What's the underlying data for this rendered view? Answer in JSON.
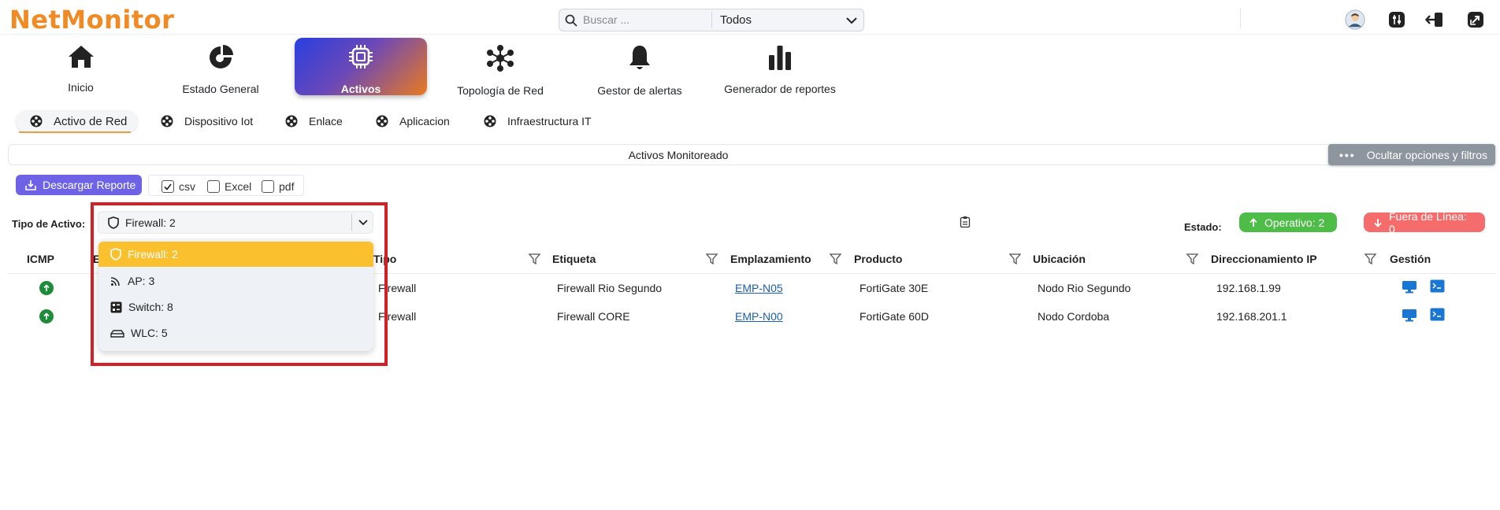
{
  "app": {
    "logo": "NetMonitor"
  },
  "search": {
    "placeholder": "Buscar ...",
    "scope": "Todos"
  },
  "modules": [
    {
      "label": "Inicio",
      "icon": "home-icon"
    },
    {
      "label": "Estado General",
      "icon": "pie-chart-icon"
    },
    {
      "label": "Activos",
      "icon": "chip-icon",
      "active": true
    },
    {
      "label": "Topología de Red",
      "icon": "network-icon"
    },
    {
      "label": "Gestor de alertas",
      "icon": "bell-icon"
    },
    {
      "label": "Generador de reportes",
      "icon": "bar-chart-icon"
    }
  ],
  "subtabs": [
    {
      "label": "Activo de Red",
      "active": true
    },
    {
      "label": "Dispositivo Iot"
    },
    {
      "label": "Enlace"
    },
    {
      "label": "Aplicacion"
    },
    {
      "label": "Infraestructura IT"
    }
  ],
  "section": {
    "title": "Activos Monitoreado",
    "toggle_label": "Ocultar opciones y filtros"
  },
  "download": {
    "label": "Descargar Reporte",
    "formats": [
      {
        "label": "csv",
        "checked": true
      },
      {
        "label": "Excel",
        "checked": false
      },
      {
        "label": "pdf",
        "checked": false
      }
    ]
  },
  "filters": {
    "tipo_label": "Tipo de Activo:",
    "tipo_value": "Firewall: 2",
    "tipo_options": [
      {
        "label": "Firewall: 2",
        "icon": "shield-icon",
        "selected": true
      },
      {
        "label": "AP: 3",
        "icon": "wifi-icon"
      },
      {
        "label": "Switch: 8",
        "icon": "switch-icon"
      },
      {
        "label": "WLC: 5",
        "icon": "router-icon"
      }
    ],
    "estado_label": "Estado:",
    "operativo": "Operativo: 2",
    "fuera_linea": "Fuera de Línea: 0"
  },
  "table": {
    "headers": [
      "ICMP",
      "E",
      "Tipo",
      "Etiqueta",
      "Emplazamiento",
      "Producto",
      "Ubicación",
      "Direccionamiento IP",
      "Gestión"
    ],
    "rows": [
      {
        "tipo": "Firewall",
        "etiqueta": "Firewall Rio Segundo",
        "emplazamiento": "EMP-N05",
        "producto": "FortiGate 30E",
        "ubicacion": "Nodo Rio Segundo",
        "ip": "192.168.1.99"
      },
      {
        "tipo": "Firewall",
        "etiqueta": "Firewall CORE",
        "emplazamiento": "EMP-N00",
        "producto": "FortiGate 60D",
        "ubicacion": "Nodo Cordoba",
        "ip": "192.168.201.1"
      }
    ]
  },
  "colors": {
    "brand": "#f08a24",
    "primary_button": "#6e63e6",
    "operativo": "#4dbd47",
    "fuera_linea": "#f46c6c",
    "dropdown_selected": "#fbc02d",
    "highlight_frame": "#d32027"
  }
}
